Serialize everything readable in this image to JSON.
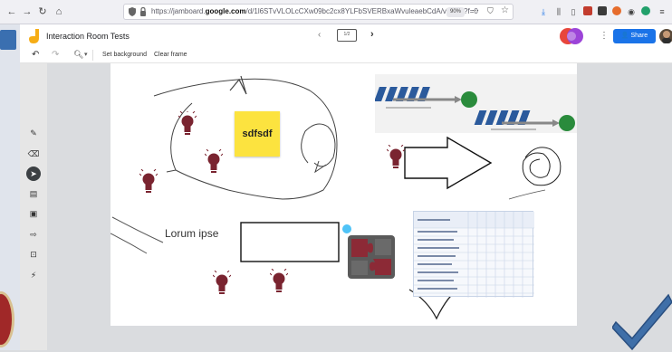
{
  "browser": {
    "url_prefix": "https://jamboard.",
    "url_domain": "google.com",
    "url_suffix": "/d/1l6STvVLOLcCXw09bc2cx8YLFbSVERBxaWvuleaebCdA/viewer?f=0",
    "zoom": "90%",
    "more": "···"
  },
  "app": {
    "title": "Interaction Room Tests",
    "frame_indicator": "1/2",
    "share_label": "Share"
  },
  "toolbar": {
    "set_background": "Set background",
    "clear_frame": "Clear frame"
  },
  "canvas": {
    "sticky_note_text": "sdfsdf",
    "text_box": "Lorum ipse"
  },
  "colors": {
    "accent": "#1a73e8",
    "sticky": "#fce33f",
    "bulb": "#7a2430",
    "puzzle": "#8c2a36"
  }
}
